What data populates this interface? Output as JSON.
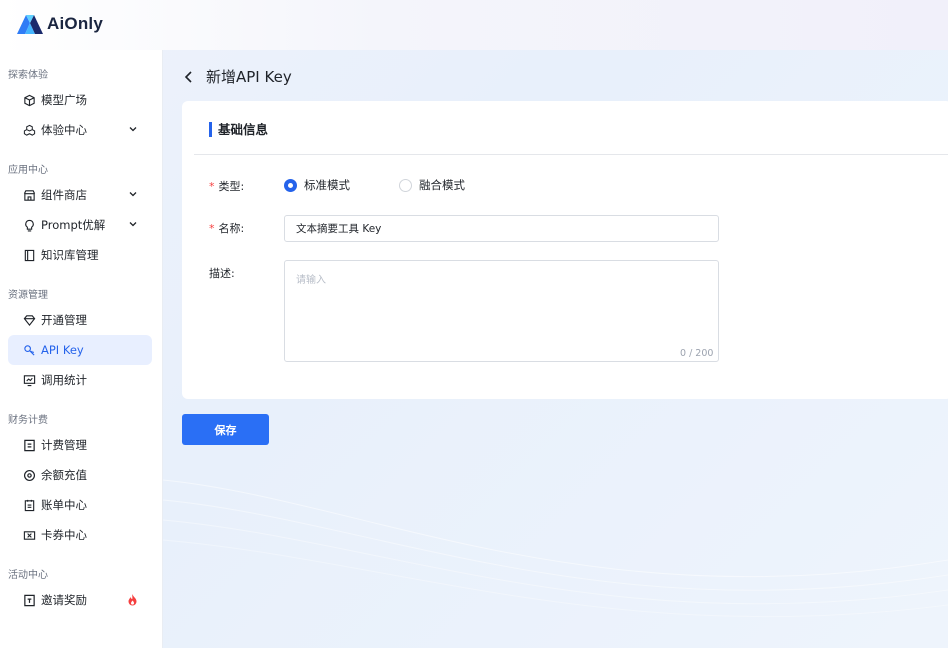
{
  "app": {
    "brand": "AiOnly"
  },
  "sidebar": {
    "groups": [
      {
        "title": "探索体验",
        "items": [
          {
            "label": "模型广场",
            "icon": "cube-icon"
          },
          {
            "label": "体验中心",
            "icon": "cubes-icon",
            "expandable": true
          }
        ]
      },
      {
        "title": "应用中心",
        "items": [
          {
            "label": "组件商店",
            "icon": "store-icon",
            "expandable": true
          },
          {
            "label": "Prompt优解",
            "icon": "bulb-icon",
            "expandable": true
          },
          {
            "label": "知识库管理",
            "icon": "book-icon"
          }
        ]
      },
      {
        "title": "资源管理",
        "items": [
          {
            "label": "开通管理",
            "icon": "diamond-icon"
          },
          {
            "label": "API Key",
            "icon": "key-icon",
            "active": true
          },
          {
            "label": "调用统计",
            "icon": "chart-icon"
          }
        ]
      },
      {
        "title": "财务计费",
        "items": [
          {
            "label": "计费管理",
            "icon": "billing-icon"
          },
          {
            "label": "余额充值",
            "icon": "coin-icon"
          },
          {
            "label": "账单中心",
            "icon": "bill-icon"
          },
          {
            "label": "卡券中心",
            "icon": "coupon-icon"
          }
        ]
      },
      {
        "title": "活动中心",
        "items": [
          {
            "label": "邀请奖励",
            "icon": "gift-icon",
            "badge": "fire-icon"
          }
        ]
      }
    ]
  },
  "page": {
    "title": "新增API Key"
  },
  "form": {
    "section_title": "基础信息",
    "type": {
      "label": "类型:",
      "required": true,
      "options": [
        "标准模式",
        "融合模式"
      ],
      "selected": "标准模式"
    },
    "name": {
      "label": "名称:",
      "required": true,
      "value": "文本摘要工具 Key"
    },
    "description": {
      "label": "描述:",
      "placeholder": "请输入",
      "value": "",
      "counter": "0 / 200"
    },
    "required_mark": "*"
  },
  "actions": {
    "save_label": "保存"
  },
  "colors": {
    "accent": "#2563eb",
    "active_bg": "#e8efff",
    "required": "#f53f3f"
  }
}
